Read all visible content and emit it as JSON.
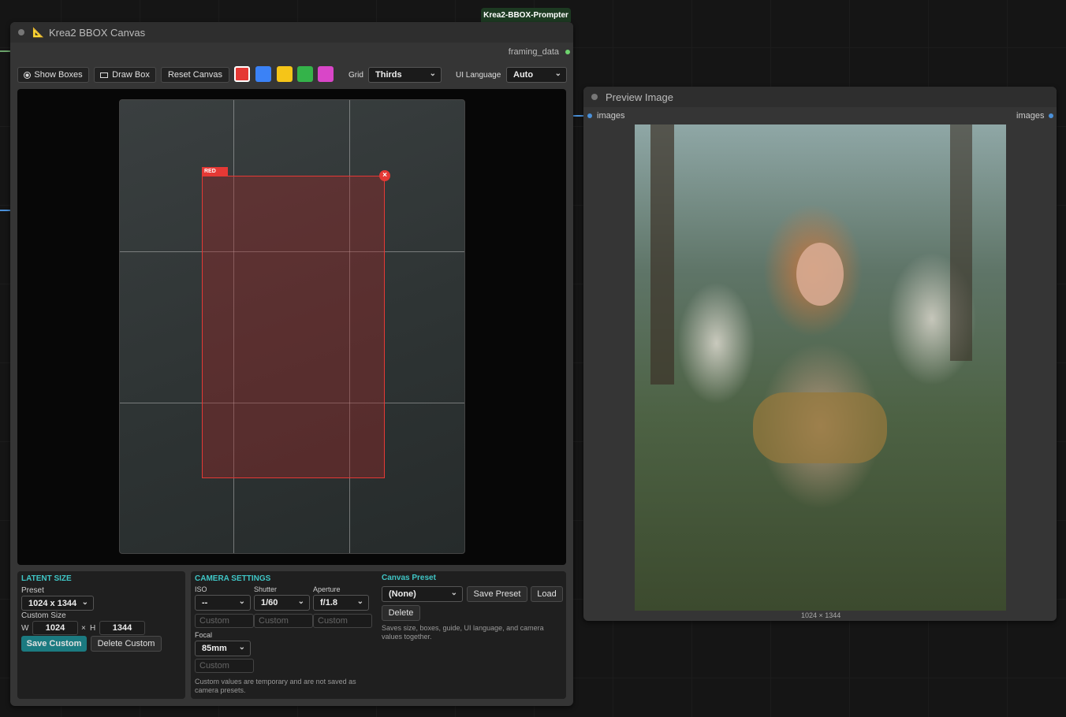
{
  "top_tag": "Krea2-BBOX-Prompter",
  "canvas_node": {
    "title": "Krea2 BBOX Canvas",
    "output_label": "framing_data",
    "toolbar": {
      "show_boxes": "Show Boxes",
      "draw_box": "Draw Box",
      "reset_canvas": "Reset Canvas",
      "colors": [
        "#e53935",
        "#3b82f6",
        "#f5c518",
        "#34b34a",
        "#d946c8"
      ],
      "grid_label": "Grid",
      "grid_value": "Thirds",
      "ui_language_label": "UI Language",
      "ui_language_value": "Auto"
    },
    "box": {
      "label": "RED",
      "close": "×",
      "color": "#e53935"
    },
    "latent_size": {
      "title": "LATENT SIZE",
      "preset_label": "Preset",
      "preset_value": "1024 x 1344",
      "custom_size_label": "Custom Size",
      "w_label": "W",
      "w_value": "1024",
      "x_sep": "×",
      "h_label": "H",
      "h_value": "1344",
      "save_custom": "Save Custom",
      "delete_custom": "Delete Custom"
    },
    "camera": {
      "title": "CAMERA SETTINGS",
      "iso_label": "ISO",
      "iso_value": "--",
      "shutter_label": "Shutter",
      "shutter_value": "1/60",
      "aperture_label": "Aperture",
      "aperture_value": "f/1.8",
      "custom_placeholder": "Custom",
      "focal_label": "Focal",
      "focal_value": "85mm",
      "note": "Custom values are temporary and are not saved as camera presets."
    },
    "preset": {
      "title": "Canvas Preset",
      "value": "(None)",
      "save": "Save Preset",
      "load": "Load",
      "delete": "Delete",
      "note": "Saves size, boxes, guide, UI language, and camera values together."
    }
  },
  "preview_node": {
    "title": "Preview Image",
    "input_label": "images",
    "output_label": "images",
    "image_size": "1024 × 1344"
  }
}
